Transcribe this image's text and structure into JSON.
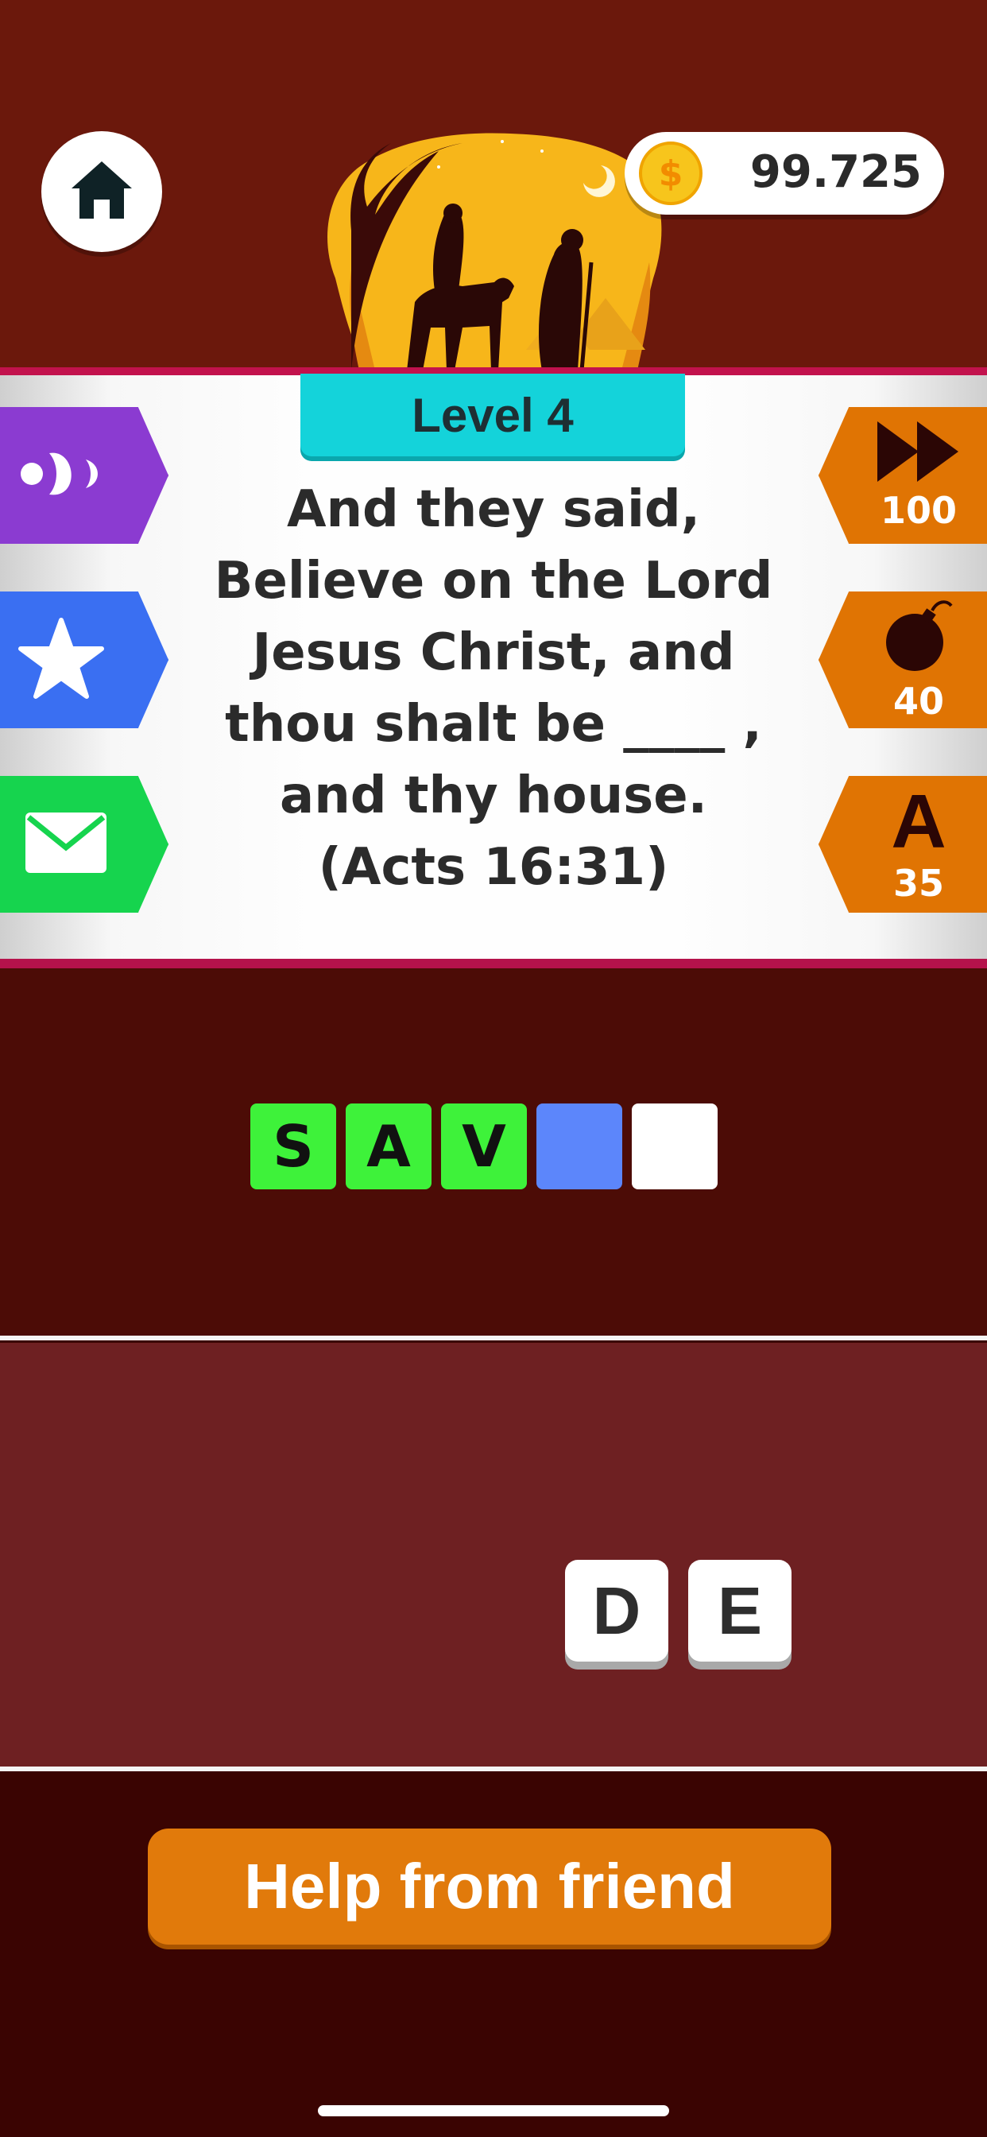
{
  "header": {
    "coins": "99.725",
    "coin_symbol": "$"
  },
  "question": {
    "level": "Level 4",
    "text": "And they said, Believe on the Lord Jesus Christ, and thou shalt be ____ , and thy house. (Acts 16:31)"
  },
  "left_actions": [
    {
      "name": "sound",
      "icon": "speaker-icon",
      "color": "#8b3bd1"
    },
    {
      "name": "rate",
      "icon": "star-icon",
      "color": "#3a6ff2"
    },
    {
      "name": "share",
      "icon": "mail-icon",
      "color": "#16d44e"
    }
  ],
  "powerups": {
    "skip": {
      "icon": "fast-forward-icon",
      "cost": "100"
    },
    "bomb": {
      "icon": "bomb-icon",
      "cost": "40"
    },
    "letter": {
      "label": "A",
      "cost": "35"
    }
  },
  "answer_slots": [
    {
      "letter": "S",
      "state": "revealed"
    },
    {
      "letter": "A",
      "state": "revealed"
    },
    {
      "letter": "V",
      "state": "revealed"
    },
    {
      "letter": "",
      "state": "selected"
    },
    {
      "letter": "",
      "state": "empty"
    }
  ],
  "letter_tiles": [
    "D",
    "E"
  ],
  "help_button": "Help from friend",
  "colors": {
    "header_bg": "#6b180c",
    "revealed_slot": "#3ef23a",
    "selected_slot": "#5c86fb",
    "powerup": "#e07403",
    "level_badge": "#14d3da"
  }
}
